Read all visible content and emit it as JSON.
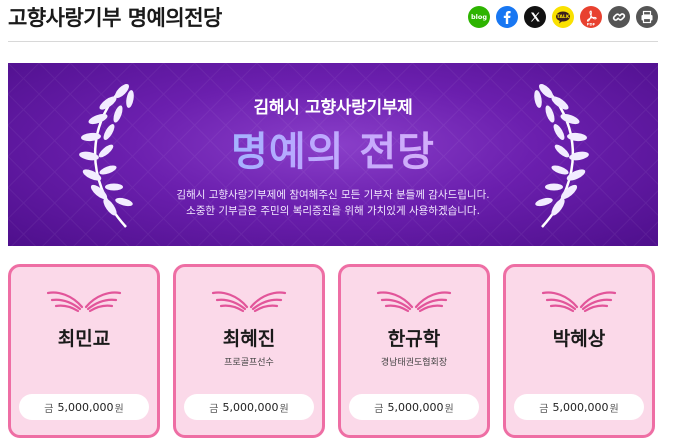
{
  "header": {
    "title": "고향사랑기부 명예의전당",
    "share": [
      {
        "id": "blog",
        "label": "blog",
        "color": "#2db400"
      },
      {
        "id": "facebook",
        "label": "f",
        "color": "#1877f2"
      },
      {
        "id": "x",
        "label": "X",
        "color": "#111111"
      },
      {
        "id": "kakaotalk",
        "label": "TALK",
        "color": "#fae100"
      },
      {
        "id": "pdf",
        "label": "PDF",
        "color": "#e8412f"
      },
      {
        "id": "link",
        "label": "link",
        "color": "#555555"
      },
      {
        "id": "print",
        "label": "print",
        "color": "#555555"
      }
    ]
  },
  "banner": {
    "subtitle": "김해시 고향사랑기부제",
    "title": "명예의 전당",
    "line1": "김해시 고향사랑기부제에 참여해주신 모든 기부자 분들께 감사드립니다.",
    "line2": "소중한 기부금은 주민의 복리증진을 위해 가치있게 사용하겠습니다."
  },
  "donors": [
    {
      "name": "최민교",
      "role": "",
      "amount_prefix": "금",
      "amount": "5,000,000",
      "unit": "원"
    },
    {
      "name": "최혜진",
      "role": "프로골프선수",
      "amount_prefix": "금",
      "amount": "5,000,000",
      "unit": "원"
    },
    {
      "name": "한규학",
      "role": "경남태권도협회장",
      "amount_prefix": "금",
      "amount": "5,000,000",
      "unit": "원"
    },
    {
      "name": "박혜상",
      "role": "",
      "amount_prefix": "금",
      "amount": "5,000,000",
      "unit": "원"
    }
  ],
  "colors": {
    "card_bg": "#fbd9e9",
    "card_border": "#ee6ea4",
    "banner_purple": "#6b1fae"
  }
}
